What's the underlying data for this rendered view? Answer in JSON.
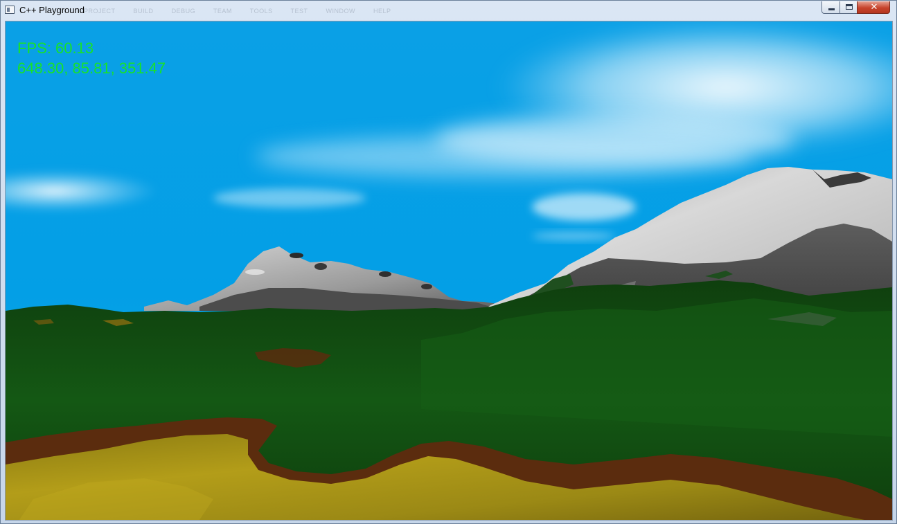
{
  "window": {
    "title": "C++ Playground",
    "ghost_menu": [
      "PROJECT",
      "BUILD",
      "DEBUG",
      "TEAM",
      "TOOLS",
      "TEST",
      "WINDOW",
      "HELP"
    ],
    "controls": {
      "minimize": "minimize-icon",
      "maximize": "maximize-icon",
      "close": "close-icon"
    }
  },
  "hud": {
    "fps_text": "FPS: 60.13",
    "camera_position_text": "648.30, 85.81, 351.47",
    "text_color": "#17e22a"
  },
  "scene": {
    "sky_color": "#06a0e4",
    "grass_color": "#124f12",
    "sand_color": "#a89416",
    "dirt_color": "#5a2c0e",
    "snow_color": "#c8c8c8"
  }
}
